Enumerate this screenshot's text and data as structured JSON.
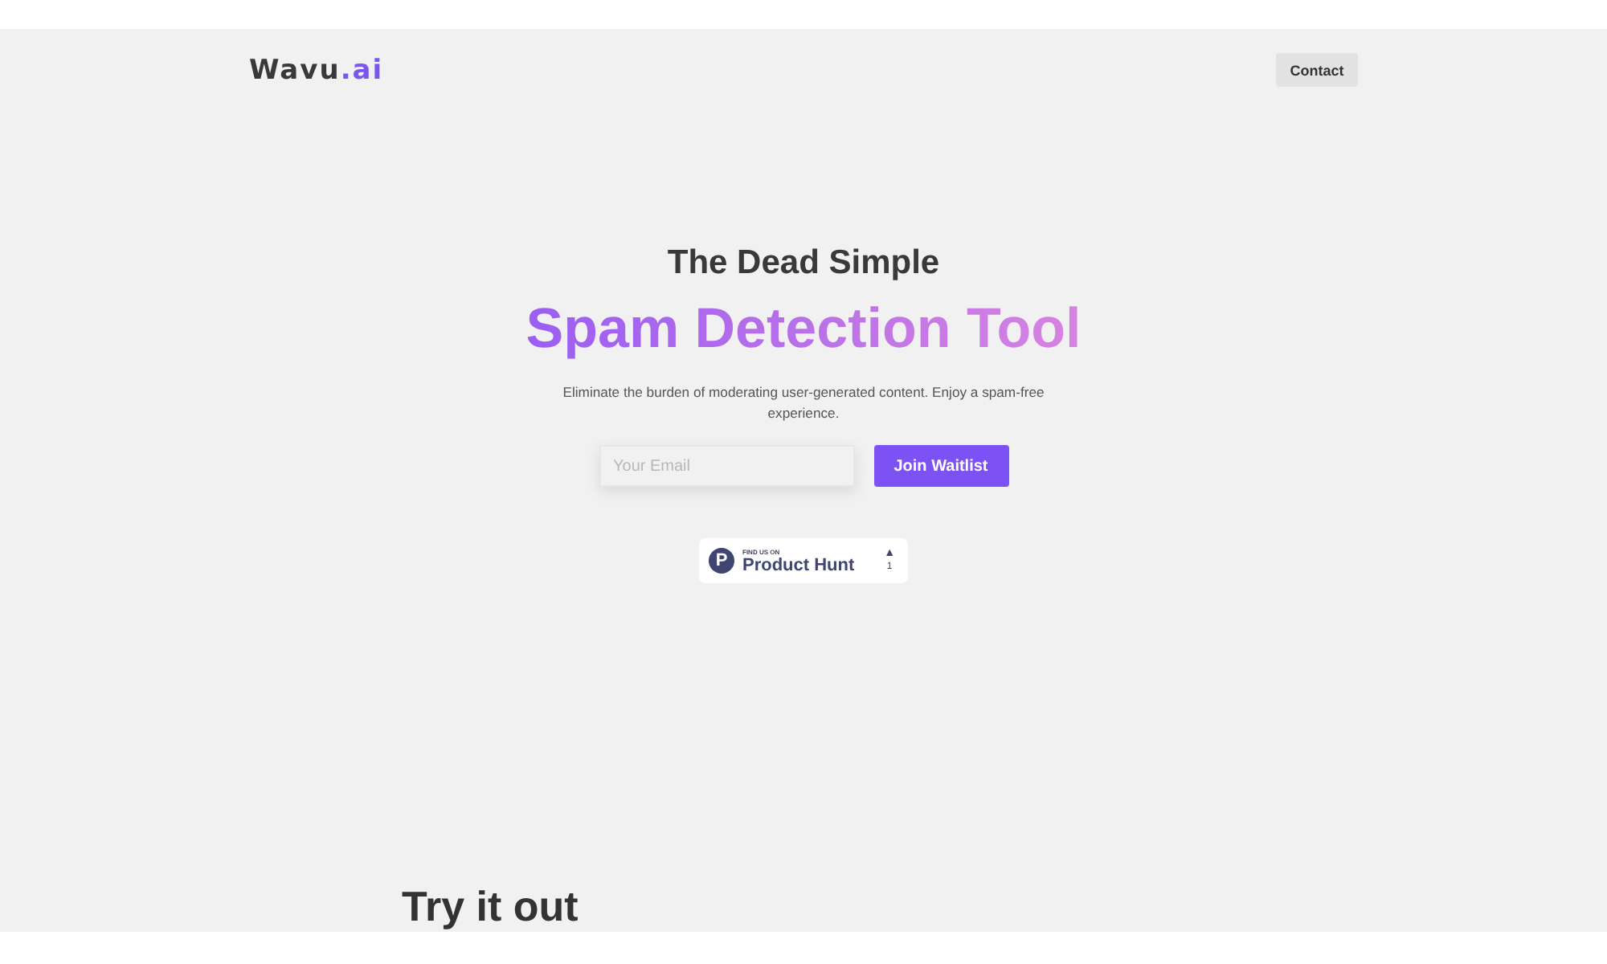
{
  "header": {
    "logo": {
      "main": "Wavu",
      "accent": ".ai"
    },
    "contact_button": "Contact"
  },
  "hero": {
    "eyebrow": "The Dead Simple",
    "title": "Spam Detection Tool",
    "description": "Eliminate the burden of moderating user-generated content. Enjoy a spam-free experience.",
    "email_field": {
      "placeholder": "Your Email"
    },
    "submit_button": "Join Waitlist",
    "badge": {
      "logo_letter": "P",
      "caption": "FIND US ON",
      "name": "Product Hunt",
      "vote_arrow": "▲",
      "votes": "1"
    }
  },
  "section": {
    "heading": "Try it out"
  }
}
